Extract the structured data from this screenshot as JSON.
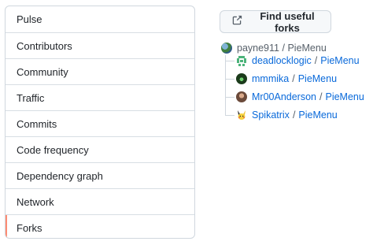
{
  "sidebar": {
    "items": [
      {
        "label": "Pulse"
      },
      {
        "label": "Contributors"
      },
      {
        "label": "Community"
      },
      {
        "label": "Traffic"
      },
      {
        "label": "Commits"
      },
      {
        "label": "Code frequency"
      },
      {
        "label": "Dependency graph"
      },
      {
        "label": "Network"
      },
      {
        "label": "Forks"
      }
    ],
    "selected": "Forks"
  },
  "find_forks_button": {
    "label": "Find useful forks",
    "icon": "link-external-icon"
  },
  "forks_tree": {
    "root": {
      "owner": "payne911",
      "separator": "/",
      "repo": "PieMenu"
    },
    "forks": [
      {
        "owner": "deadlocklogic",
        "repo": "PieMenu",
        "avatar": "green-identicon"
      },
      {
        "owner": "mmmika",
        "repo": "PieMenu",
        "avatar": "dark-green-avatar"
      },
      {
        "owner": "Mr00Anderson",
        "repo": "PieMenu",
        "avatar": "photo-avatar"
      },
      {
        "owner": "Spikatrix",
        "repo": "PieMenu",
        "avatar": "pikachu-avatar"
      }
    ]
  },
  "colors": {
    "selected_marker": "#fd8c73",
    "link": "#0969da",
    "border": "#d0d7de"
  }
}
